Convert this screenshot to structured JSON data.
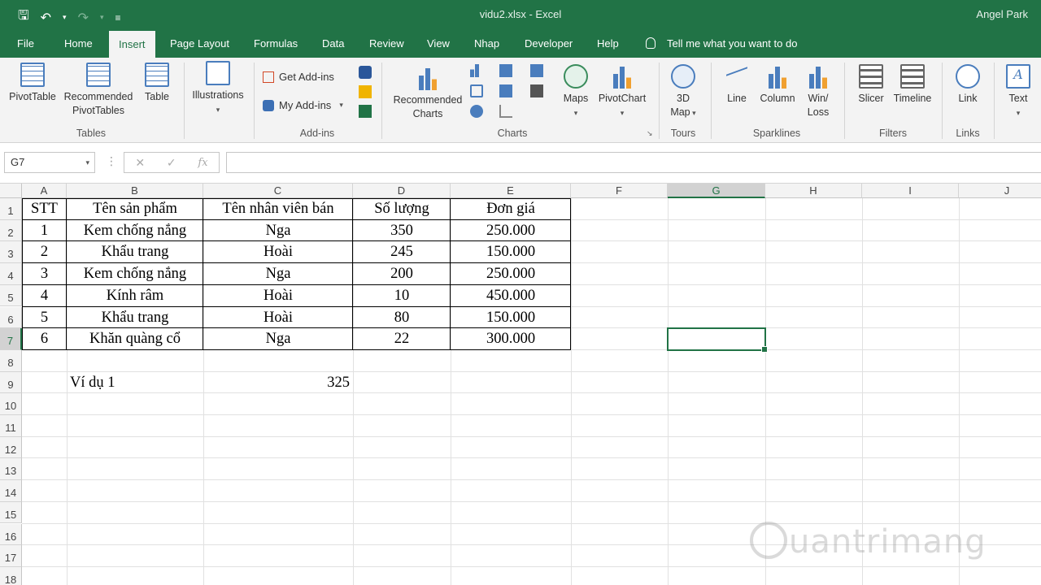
{
  "titlebar": {
    "doc_title": "vidu2.xlsx  -  Excel",
    "user": "Angel Park"
  },
  "qat": {
    "save_icon": "save-icon",
    "undo_icon": "undo-icon",
    "redo_icon": "redo-icon",
    "customize_icon": "customize-icon"
  },
  "tabs": [
    "File",
    "Home",
    "Insert",
    "Page Layout",
    "Formulas",
    "Data",
    "Review",
    "View",
    "Nhap",
    "Developer",
    "Help"
  ],
  "active_tab": "Insert",
  "tellme": "Tell me what you want to do",
  "ribbon": {
    "pivottable": "PivotTable",
    "recommended_pivot_1": "Recommended",
    "recommended_pivot_2": "PivotTables",
    "table": "Table",
    "tables_group": "Tables",
    "illustrations": "Illustrations",
    "get_addins": "Get Add-ins",
    "my_addins": "My Add-ins",
    "addins_group": "Add-ins",
    "recommended_charts_1": "Recommended",
    "recommended_charts_2": "Charts",
    "maps": "Maps",
    "pivotchart": "PivotChart",
    "charts_group": "Charts",
    "map3d_1": "3D",
    "map3d_2": "Map",
    "tours_group": "Tours",
    "line": "Line",
    "column": "Column",
    "winloss_1": "Win/",
    "winloss_2": "Loss",
    "sparklines_group": "Sparklines",
    "slicer": "Slicer",
    "timeline": "Timeline",
    "filters_group": "Filters",
    "link": "Link",
    "links_group": "Links",
    "text": "Text"
  },
  "formula_bar": {
    "name_box": "G7",
    "formula": ""
  },
  "columns": [
    "A",
    "B",
    "C",
    "D",
    "E",
    "F",
    "G",
    "H",
    "I",
    "J"
  ],
  "rows": [
    "1",
    "2",
    "3",
    "4",
    "5",
    "6",
    "7",
    "8",
    "9",
    "10",
    "11",
    "12",
    "13",
    "14",
    "15",
    "16",
    "17",
    "18"
  ],
  "table": {
    "headers": [
      "STT",
      "Tên sản phẩm",
      "Tên nhân viên bán",
      "Số lượng",
      "Đơn giá"
    ],
    "rows": [
      [
        "1",
        "Kem chống nắng",
        "Nga",
        "350",
        "250.000"
      ],
      [
        "2",
        "Khẩu trang",
        "Hoài",
        "245",
        "150.000"
      ],
      [
        "3",
        "Kem chống nắng",
        "Nga",
        "200",
        "250.000"
      ],
      [
        "4",
        "Kính râm",
        "Hoài",
        "10",
        "450.000"
      ],
      [
        "5",
        "Khẩu trang",
        "Hoài",
        "80",
        "150.000"
      ],
      [
        "6",
        "Khăn quàng cổ",
        "Nga",
        "22",
        "300.000"
      ]
    ]
  },
  "example": {
    "label": "Ví dụ 1",
    "value": "325"
  },
  "selected_cell": "G7",
  "watermark": "uantrimang",
  "colors": {
    "accent": "#217346",
    "ribbon_bg": "#f3f3f3"
  }
}
